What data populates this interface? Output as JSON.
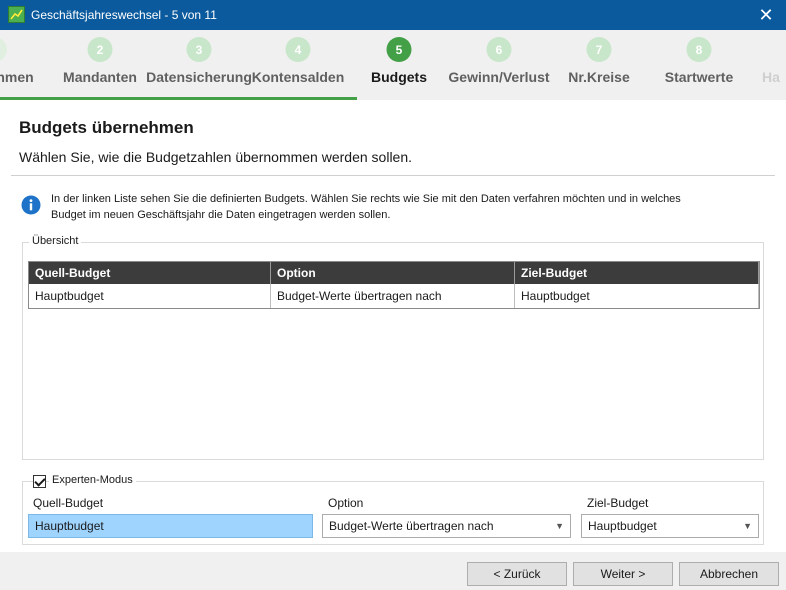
{
  "window": {
    "title": "Geschäftsjahreswechsel - 5 von 11",
    "close_glyph": "✕"
  },
  "steps": [
    {
      "number": "",
      "label": "nmen"
    },
    {
      "number": "2",
      "label": "Mandanten"
    },
    {
      "number": "3",
      "label": "Datensicherung"
    },
    {
      "number": "4",
      "label": "Kontensalden"
    },
    {
      "number": "5",
      "label": "Budgets"
    },
    {
      "number": "6",
      "label": "Gewinn/Verlust"
    },
    {
      "number": "7",
      "label": "Nr.Kreise"
    },
    {
      "number": "8",
      "label": "Startwerte"
    },
    {
      "number": "",
      "label": "Ha"
    }
  ],
  "page": {
    "heading": "Budgets übernehmen",
    "subheading": "Wählen Sie, wie die Budgetzahlen übernommen werden sollen.",
    "info_line1": "In der linken Liste sehen Sie die definierten Budgets. Wählen Sie rechts wie Sie mit den Daten verfahren möchten und in welches",
    "info_line2": "Budget im neuen Geschäftsjahr die Daten eingetragen werden sollen."
  },
  "overview": {
    "legend": "Übersicht",
    "columns": [
      "Quell-Budget",
      "Option",
      "Ziel-Budget"
    ],
    "rows": [
      [
        "Hauptbudget",
        "Budget-Werte übertragen nach",
        "Hauptbudget"
      ]
    ]
  },
  "expert": {
    "legend": "Experten-Modus",
    "checked": true,
    "source_label": "Quell-Budget",
    "source_value": "Hauptbudget",
    "option_label": "Option",
    "option_value": "Budget-Werte übertragen nach",
    "target_label": "Ziel-Budget",
    "target_value": "Hauptbudget"
  },
  "buttons": {
    "back": "< Zurück",
    "next": "Weiter >",
    "cancel": "Abbrechen"
  },
  "colors": {
    "titlebar": "#0b5a9e",
    "active_step": "#43a047",
    "inactive_step": "#c8e6c9",
    "selection": "#9fd4ff"
  }
}
